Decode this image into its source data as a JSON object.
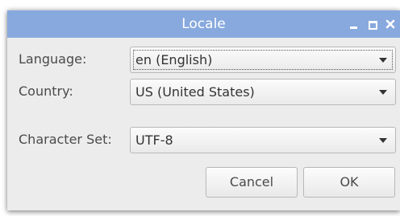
{
  "window": {
    "title": "Locale"
  },
  "titlebar": {
    "minimize_icon": "minimize-icon",
    "maximize_icon": "maximize-icon",
    "close_icon": "close-icon",
    "color": "#87a9de"
  },
  "form": {
    "language": {
      "label": "Language:",
      "value": "en (English)"
    },
    "country": {
      "label": "Country:",
      "value": "US (United States)"
    },
    "charset": {
      "label": "Character Set:",
      "value": "UTF-8"
    }
  },
  "buttons": {
    "cancel": "Cancel",
    "ok": "OK"
  }
}
